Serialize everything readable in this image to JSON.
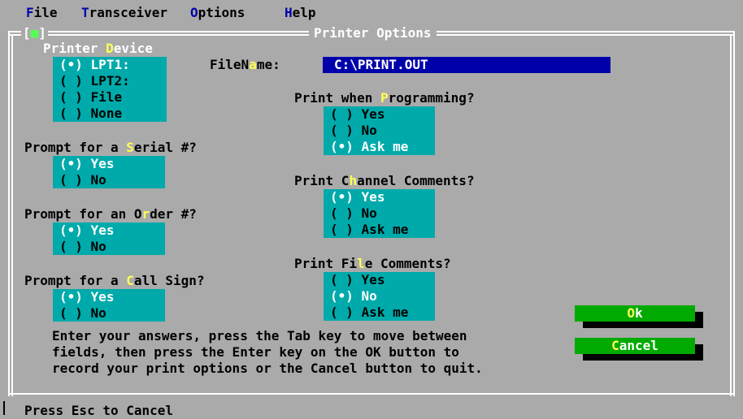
{
  "menu": {
    "file": {
      "hotkey": "F",
      "rest": "ile"
    },
    "transceiver": {
      "hotkey": "T",
      "rest": "ransceiver"
    },
    "options": {
      "hotkey": "O",
      "rest": "ptions"
    },
    "help": {
      "hotkey": "H",
      "rest": "elp"
    }
  },
  "dialog": {
    "title": "Printer Options",
    "system_box": {
      "left": "[",
      "dot": "■",
      "right": "]"
    }
  },
  "printer_device": {
    "label_pre": "Printer ",
    "label_hk": "D",
    "label_post": "evice",
    "options": [
      {
        "mark": "(•)",
        "label": "LPT1:"
      },
      {
        "mark": "( )",
        "label": "LPT2:"
      },
      {
        "mark": "( )",
        "label": "File"
      },
      {
        "mark": "( )",
        "label": "None"
      }
    ]
  },
  "filename": {
    "label_pre": "FileN",
    "label_hk": "a",
    "label_post": "me:",
    "value": "C:\\PRINT.OUT"
  },
  "serial": {
    "q_pre": "Prompt for a ",
    "q_hk": "S",
    "q_post": "erial #?",
    "options": [
      {
        "mark": "(•)",
        "label": "Yes"
      },
      {
        "mark": "( )",
        "label": "No"
      }
    ]
  },
  "order": {
    "q_pre": "Prompt for an O",
    "q_hk": "r",
    "q_post": "der #?",
    "options": [
      {
        "mark": "(•)",
        "label": "Yes"
      },
      {
        "mark": "( )",
        "label": "No"
      }
    ]
  },
  "callsign": {
    "q_pre": "Prompt for a ",
    "q_hk": "C",
    "q_post": "all Sign?",
    "options": [
      {
        "mark": "(•)",
        "label": "Yes"
      },
      {
        "mark": "( )",
        "label": "No"
      }
    ]
  },
  "programming": {
    "q_pre": "Print when ",
    "q_hk": "P",
    "q_post": "rogramming?",
    "options": [
      {
        "mark": "( )",
        "label": "Yes"
      },
      {
        "mark": "( )",
        "label": "No"
      },
      {
        "mark": "(•)",
        "label": "Ask me"
      }
    ]
  },
  "channel": {
    "q_pre": "Print C",
    "q_hk": "h",
    "q_post": "annel Comments?",
    "options": [
      {
        "mark": "(•)",
        "label": "Yes"
      },
      {
        "mark": "( )",
        "label": "No"
      },
      {
        "mark": "( )",
        "label": "Ask me"
      }
    ]
  },
  "filecomments": {
    "q_pre": "Print Fi",
    "q_hk": "l",
    "q_post": "e Comments?",
    "options": [
      {
        "mark": "( )",
        "label": "Yes"
      },
      {
        "mark": "(•)",
        "label": "No"
      },
      {
        "mark": "( )",
        "label": "Ask me"
      }
    ]
  },
  "buttons": {
    "ok": {
      "hk": "O",
      "rest": "k"
    },
    "cancel": {
      "hk": "C",
      "rest": "ancel"
    }
  },
  "help": {
    "lines": [
      "Enter your answers, press the Tab key to move between",
      "fields, then press the Enter key on the OK button to",
      "record your print options or the Cancel button to quit."
    ]
  },
  "status": {
    "text": "Press Esc to Cancel"
  },
  "colors": {
    "desktop": "#aaaaaa",
    "radio_bg": "#00aaaa",
    "input_bg": "#0000aa",
    "button_bg": "#00aa00",
    "hotkey": "#ffff55",
    "menu_hotkey": "#0000aa"
  }
}
